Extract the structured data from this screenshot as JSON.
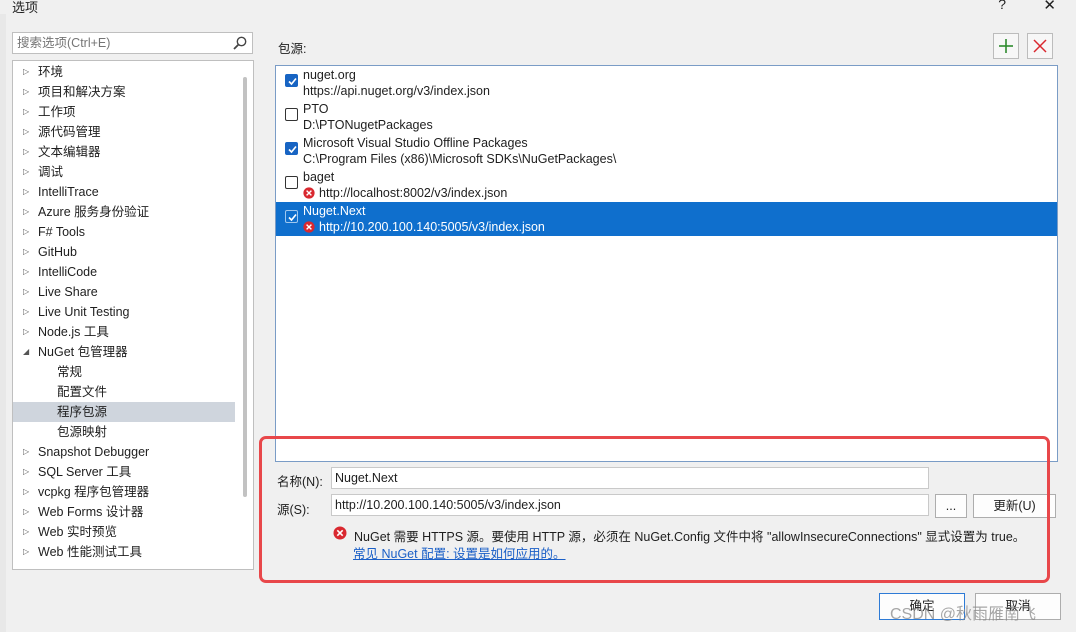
{
  "window": {
    "title": "选项",
    "help": "?",
    "close": "✕"
  },
  "search": {
    "placeholder": "搜索选项(Ctrl+E)"
  },
  "tree": [
    {
      "label": "环境",
      "state": "collapsed"
    },
    {
      "label": "项目和解决方案",
      "state": "collapsed"
    },
    {
      "label": "工作项",
      "state": "collapsed"
    },
    {
      "label": "源代码管理",
      "state": "collapsed"
    },
    {
      "label": "文本编辑器",
      "state": "collapsed"
    },
    {
      "label": "调试",
      "state": "collapsed"
    },
    {
      "label": "IntelliTrace",
      "state": "collapsed"
    },
    {
      "label": "Azure 服务身份验证",
      "state": "collapsed"
    },
    {
      "label": "F# Tools",
      "state": "collapsed"
    },
    {
      "label": "GitHub",
      "state": "collapsed"
    },
    {
      "label": "IntelliCode",
      "state": "collapsed"
    },
    {
      "label": "Live Share",
      "state": "collapsed"
    },
    {
      "label": "Live Unit Testing",
      "state": "collapsed"
    },
    {
      "label": "Node.js 工具",
      "state": "collapsed"
    },
    {
      "label": "NuGet 包管理器",
      "state": "expanded"
    },
    {
      "label": "常规",
      "state": "child"
    },
    {
      "label": "配置文件",
      "state": "child"
    },
    {
      "label": "程序包源",
      "state": "child",
      "selected": true
    },
    {
      "label": "包源映射",
      "state": "child"
    },
    {
      "label": "Snapshot Debugger",
      "state": "collapsed"
    },
    {
      "label": "SQL Server 工具",
      "state": "collapsed"
    },
    {
      "label": "vcpkg 程序包管理器",
      "state": "collapsed"
    },
    {
      "label": "Web Forms 设计器",
      "state": "collapsed"
    },
    {
      "label": "Web 实时预览",
      "state": "collapsed"
    },
    {
      "label": "Web 性能测试工具",
      "state": "collapsed"
    }
  ],
  "main": {
    "sources_label": "包源:"
  },
  "sources": [
    {
      "name": "nuget.org",
      "url": "https://api.nuget.org/v3/index.json",
      "checked": true,
      "error": false
    },
    {
      "name": "PTO",
      "url": "D:\\PTONugetPackages",
      "checked": false,
      "error": false
    },
    {
      "name": "Microsoft Visual Studio Offline Packages",
      "url": "C:\\Program Files (x86)\\Microsoft SDKs\\NuGetPackages\\",
      "checked": true,
      "error": false
    },
    {
      "name": "baget",
      "url": "http://localhost:8002/v3/index.json",
      "checked": false,
      "error": true
    },
    {
      "name": "Nuget.Next",
      "url": "http://10.200.100.140:5005/v3/index.json",
      "checked": true,
      "error": true,
      "selected": true
    }
  ],
  "form": {
    "name_label": "名称(N):",
    "name_value": "Nuget.Next",
    "source_label": "源(S):",
    "source_value": "http://10.200.100.140:5005/v3/index.json",
    "browse_label": "...",
    "update_label": "更新(U)",
    "warning": "NuGet 需要 HTTPS 源。要使用 HTTP 源，必须在 NuGet.Config 文件中将 \"allowInsecureConnections\" 显式设置为 true。",
    "link": "常见 NuGet 配置: 设置是如何应用的。"
  },
  "footer": {
    "ok_label": "确定",
    "cancel_label": "取消",
    "watermark": "CSDN @秋雨雁南飞"
  },
  "colors": {
    "selection": "#0f6fcd",
    "highlight_box": "#e8474a",
    "link": "#1a5fc7",
    "error": "#d9282f",
    "add": "#2e8b2e"
  },
  "icons": {
    "search": "magnifier-icon",
    "add": "plus-icon",
    "remove": "x-icon",
    "error": "error-circle-icon"
  }
}
